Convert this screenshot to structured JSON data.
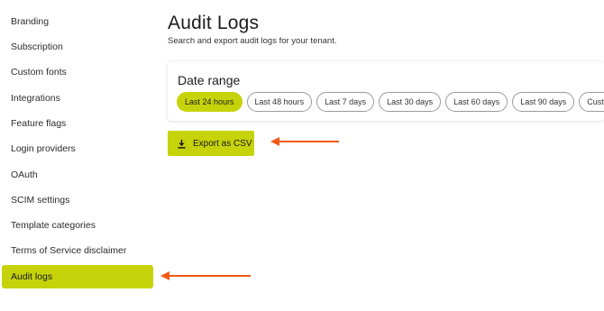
{
  "sidebar": {
    "items": [
      {
        "label": "Branding"
      },
      {
        "label": "Subscription"
      },
      {
        "label": "Custom fonts"
      },
      {
        "label": "Integrations"
      },
      {
        "label": "Feature flags"
      },
      {
        "label": "Login providers"
      },
      {
        "label": "OAuth"
      },
      {
        "label": "SCIM settings"
      },
      {
        "label": "Template categories"
      },
      {
        "label": "Terms of Service disclaimer"
      },
      {
        "label": "Audit logs"
      }
    ],
    "active_item": "Audit logs"
  },
  "main": {
    "title": "Audit Logs",
    "subtitle": "Search and export audit logs for your tenant.",
    "date_range": {
      "title": "Date range",
      "options": [
        {
          "label": "Last 24 hours"
        },
        {
          "label": "Last 48 hours"
        },
        {
          "label": "Last 7 days"
        },
        {
          "label": "Last 30 days"
        },
        {
          "label": "Last 60 days"
        },
        {
          "label": "Last 90 days"
        },
        {
          "label": "Custom"
        }
      ],
      "selected": "Last 24 hours"
    },
    "export_button": {
      "label": "Export as CSV",
      "icon": "download-icon"
    }
  },
  "colors": {
    "accent": "#c6d30a",
    "annotation_arrow": "#f05a14"
  }
}
